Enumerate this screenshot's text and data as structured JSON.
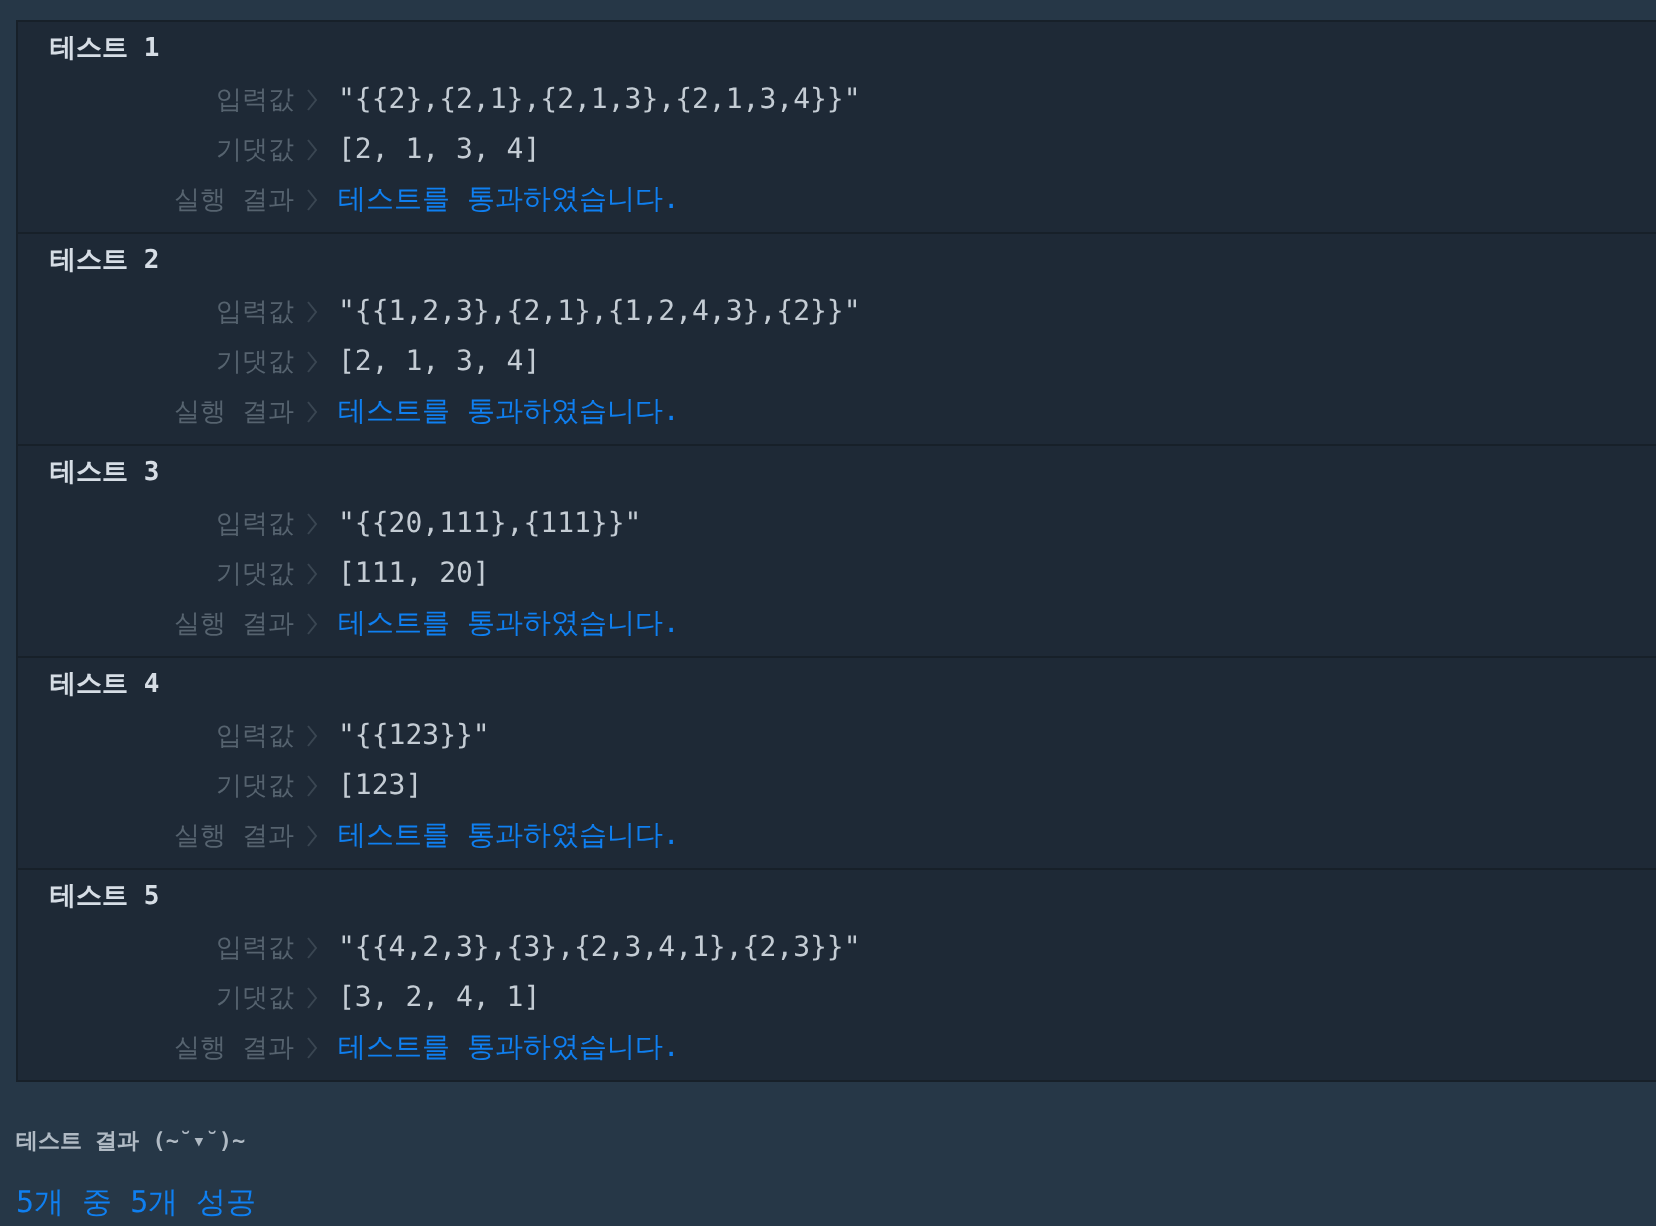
{
  "tests": [
    {
      "title": "테스트 1",
      "rows": [
        {
          "label": "입력값",
          "value": "\"{{2},{2,1},{2,1,3},{2,1,3,4}}\"",
          "kind": "plain"
        },
        {
          "label": "기댓값",
          "value": "[2, 1, 3, 4]",
          "kind": "plain"
        },
        {
          "label": "실행 결과",
          "value": "테스트를 통과하였습니다.",
          "kind": "result",
          "passed": true
        }
      ]
    },
    {
      "title": "테스트 2",
      "rows": [
        {
          "label": "입력값",
          "value": "\"{{1,2,3},{2,1},{1,2,4,3},{2}}\"",
          "kind": "plain"
        },
        {
          "label": "기댓값",
          "value": "[2, 1, 3, 4]",
          "kind": "plain"
        },
        {
          "label": "실행 결과",
          "value": "테스트를 통과하였습니다.",
          "kind": "result",
          "passed": true
        }
      ]
    },
    {
      "title": "테스트 3",
      "rows": [
        {
          "label": "입력값",
          "value": "\"{{20,111},{111}}\"",
          "kind": "plain"
        },
        {
          "label": "기댓값",
          "value": "[111, 20]",
          "kind": "plain"
        },
        {
          "label": "실행 결과",
          "value": "테스트를 통과하였습니다.",
          "kind": "result",
          "passed": true
        }
      ]
    },
    {
      "title": "테스트 4",
      "rows": [
        {
          "label": "입력값",
          "value": "\"{{123}}\"",
          "kind": "plain"
        },
        {
          "label": "기댓값",
          "value": "[123]",
          "kind": "plain"
        },
        {
          "label": "실행 결과",
          "value": "테스트를 통과하였습니다.",
          "kind": "result",
          "passed": true
        }
      ]
    },
    {
      "title": "테스트 5",
      "rows": [
        {
          "label": "입력값",
          "value": "\"{{4,2,3},{3},{2,3,4,1},{2,3}}\"",
          "kind": "plain"
        },
        {
          "label": "기댓값",
          "value": "[3, 2, 4, 1]",
          "kind": "plain"
        },
        {
          "label": "실행 결과",
          "value": "테스트를 통과하였습니다.",
          "kind": "result",
          "passed": true
        }
      ]
    }
  ],
  "summary": {
    "heading": "테스트 결과 (~˘▾˘)~",
    "result": "5개 중 5개 성공"
  }
}
